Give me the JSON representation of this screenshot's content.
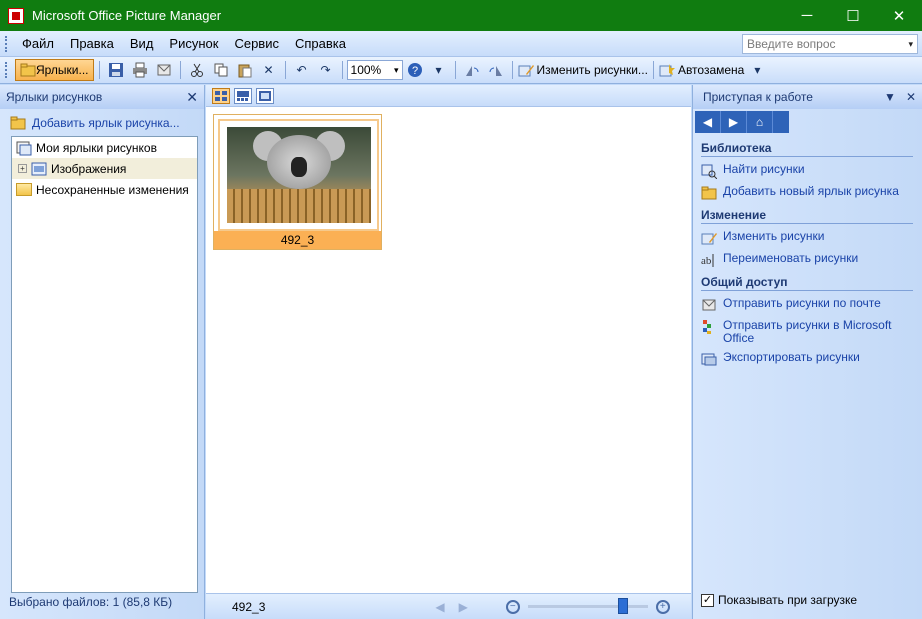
{
  "window": {
    "title": "Microsoft Office Picture Manager",
    "minimize_glyph": "─",
    "maximize_glyph": "☐",
    "close_glyph": "✕"
  },
  "menu": {
    "items": [
      {
        "label": "Файл",
        "key": "file"
      },
      {
        "label": "Правка",
        "key": "edit"
      },
      {
        "label": "Вид",
        "key": "view"
      },
      {
        "label": "Рисунок",
        "key": "picture"
      },
      {
        "label": "Сервис",
        "key": "tools"
      },
      {
        "label": "Справка",
        "key": "help"
      }
    ],
    "question_placeholder": "Введите вопрос",
    "dropdown_glyph": "▾"
  },
  "toolbar": {
    "shortcuts_label": "Ярлыки...",
    "zoom_value": "100%",
    "edit_pictures_label": "Изменить рисунки...",
    "autocorrect_label": "Автозамена",
    "help_glyph": "?",
    "undo_glyph": "↶",
    "redo_glyph": "↷",
    "delete_glyph": "✕",
    "overflow_glyph": "▾"
  },
  "left_pane": {
    "title": "Ярлыки рисунков",
    "close_glyph": "✕",
    "add_shortcut_label": "Добавить ярлык рисунка...",
    "tree": [
      {
        "label": "Мои ярлыки рисунков",
        "level": 0
      },
      {
        "label": "Изображения",
        "level": 1,
        "expander": "+"
      },
      {
        "label": "Несохраненные изменения",
        "level": 0
      }
    ],
    "status": "Выбрано файлов: 1 (85,8 КБ)"
  },
  "center": {
    "thumbnail_label": "492_3",
    "status_filename": "492_3",
    "prev_glyph": "◀",
    "next_glyph": "▶",
    "zoom_out_glyph": "−",
    "zoom_in_glyph": "+",
    "zoom_level": 0.82
  },
  "task_pane": {
    "title": "Приступая к работе",
    "menu_glyph": "▼",
    "close_glyph": "✕",
    "nav": {
      "back": "◀",
      "forward": "▶",
      "home": "⌂"
    },
    "sections": [
      {
        "title": "Библиотека",
        "links": [
          "Найти рисунки",
          "Добавить новый ярлык рисунка"
        ]
      },
      {
        "title": "Изменение",
        "links": [
          "Изменить рисунки",
          "Переименовать рисунки"
        ]
      },
      {
        "title": "Общий доступ",
        "links": [
          "Отправить рисунки по почте",
          "Отправить рисунки в Microsoft Office",
          "Экспортировать рисунки"
        ]
      }
    ],
    "show_on_startup_label": "Показывать при загрузке",
    "show_on_startup_checked": true,
    "check_glyph": "✓"
  },
  "colors": {
    "titlebar": "#107c10",
    "selection_orange": "#fbb054",
    "link_blue": "#1a43a8"
  }
}
